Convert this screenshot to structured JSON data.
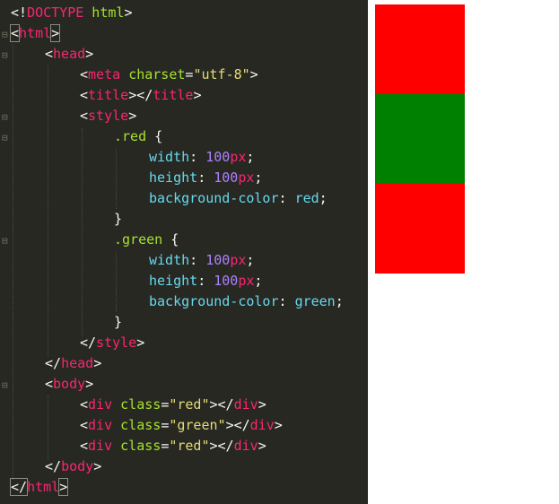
{
  "colors": {
    "editor_bg": "#272822",
    "red_box": "#ff0000",
    "green_box": "#008000"
  },
  "code": {
    "l1_open": "<!",
    "l1_kw": "DOCTYPE",
    "l1_rest": " html",
    "l1_close": ">",
    "html_tag": "html",
    "head_tag": "head",
    "meta_tag": "meta",
    "charset_attr": "charset",
    "charset_val": "\"utf-8\"",
    "title_tag": "title",
    "style_tag": "style",
    "red_selector": ".red",
    "green_selector": ".green",
    "width_prop": "width",
    "height_prop": "height",
    "bg_prop": "background-color",
    "num_100": "100",
    "unit_px": "px",
    "red_value": "red",
    "green_value": "green",
    "body_tag": "body",
    "div_tag": "div",
    "class_attr": "class",
    "class_red": "\"red\"",
    "class_green": "\"green\""
  },
  "preview": {
    "boxes": [
      "red",
      "green",
      "red"
    ]
  }
}
